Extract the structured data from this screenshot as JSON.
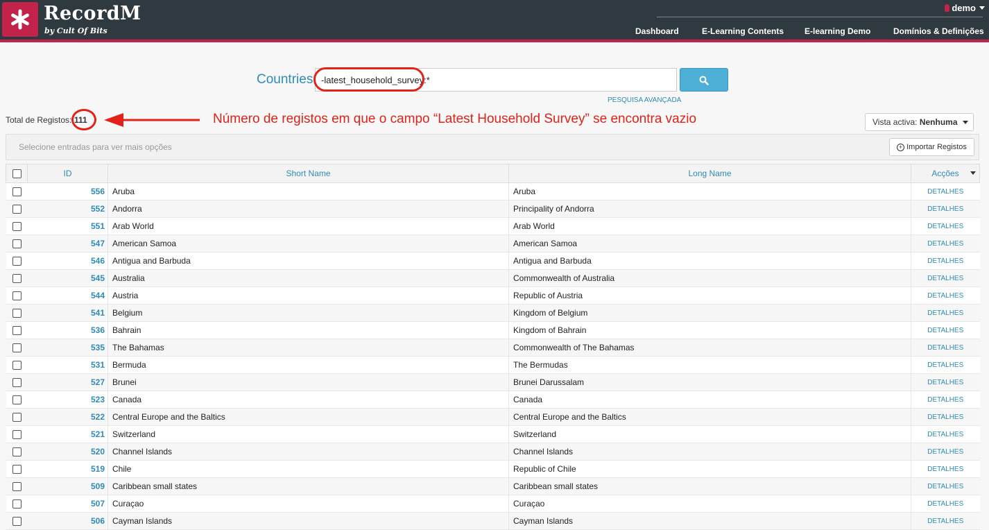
{
  "app": {
    "brand": "RecordM",
    "brand_sub": "by Cult Of Bits",
    "user": "demo",
    "accent": "#c3224a",
    "header_bg": "#2f3a40",
    "link_color": "#2f8ab8"
  },
  "nav": [
    "Dashboard",
    "E-Learning Contents",
    "E-learning Demo",
    "Domínios & Definições"
  ],
  "search": {
    "label": "Countries",
    "value": "-latest_household_survey:*",
    "advanced": "PESQUISA AVANÇADA",
    "icon": "search-icon"
  },
  "total": {
    "label": "Total de Registos:",
    "count": "111"
  },
  "annotation": {
    "text": "Número de registos em que o campo “Latest Household Survey” se encontra vazio",
    "color": "#e22118"
  },
  "view": {
    "label": "Vista activa:",
    "value": "Nenhuma"
  },
  "toolbar": {
    "hint": "Selecione entradas para ver mais opções",
    "import": "Importar Registos"
  },
  "table": {
    "headers": {
      "id": "ID",
      "short": "Short Name",
      "long": "Long Name",
      "actions": "Acções"
    },
    "action_label": "DETALHES",
    "rows": [
      {
        "id": "556",
        "short": "Aruba",
        "long": "Aruba"
      },
      {
        "id": "552",
        "short": "Andorra",
        "long": "Principality of Andorra"
      },
      {
        "id": "551",
        "short": "Arab World",
        "long": "Arab World"
      },
      {
        "id": "547",
        "short": "American Samoa",
        "long": "American Samoa"
      },
      {
        "id": "546",
        "short": "Antigua and Barbuda",
        "long": "Antigua and Barbuda"
      },
      {
        "id": "545",
        "short": "Australia",
        "long": "Commonwealth of Australia"
      },
      {
        "id": "544",
        "short": "Austria",
        "long": "Republic of Austria"
      },
      {
        "id": "541",
        "short": "Belgium",
        "long": "Kingdom of Belgium"
      },
      {
        "id": "536",
        "short": "Bahrain",
        "long": "Kingdom of Bahrain"
      },
      {
        "id": "535",
        "short": "The Bahamas",
        "long": "Commonwealth of The Bahamas"
      },
      {
        "id": "531",
        "short": "Bermuda",
        "long": "The Bermudas"
      },
      {
        "id": "527",
        "short": "Brunei",
        "long": "Brunei Darussalam"
      },
      {
        "id": "523",
        "short": "Canada",
        "long": "Canada"
      },
      {
        "id": "522",
        "short": "Central Europe and the Baltics",
        "long": "Central Europe and the Baltics"
      },
      {
        "id": "521",
        "short": "Switzerland",
        "long": "Switzerland"
      },
      {
        "id": "520",
        "short": "Channel Islands",
        "long": "Channel Islands"
      },
      {
        "id": "519",
        "short": "Chile",
        "long": "Republic of Chile"
      },
      {
        "id": "509",
        "short": "Caribbean small states",
        "long": "Caribbean small states"
      },
      {
        "id": "507",
        "short": "Curaçao",
        "long": "Curaçao"
      },
      {
        "id": "506",
        "short": "Cayman Islands",
        "long": "Cayman Islands"
      }
    ]
  }
}
